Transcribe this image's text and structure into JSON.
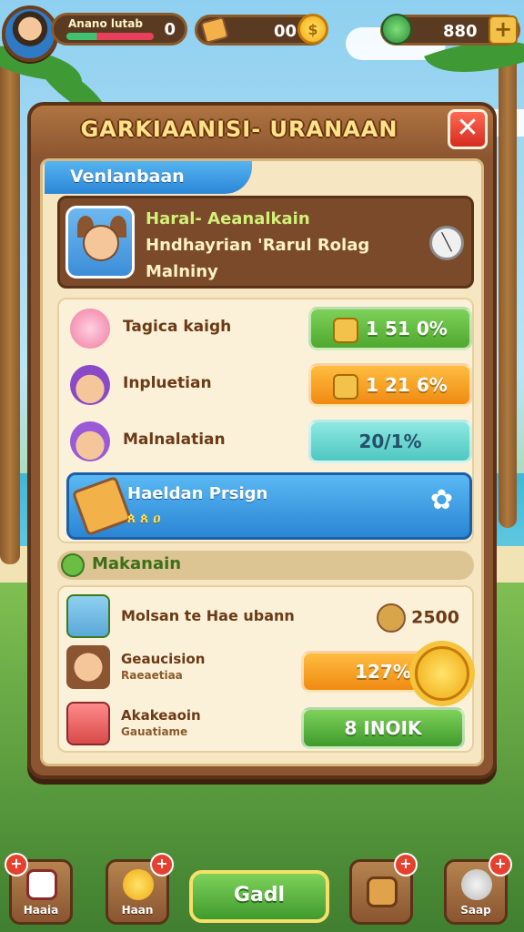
{
  "hud": {
    "player_name": "Anano lutab",
    "player_value": "0",
    "pill_middle_value": "00",
    "pill_right_value": "880",
    "plus_icon": "plus-icon"
  },
  "panel": {
    "title": "GARKIAANISI- URANAAN",
    "close_label": "✕"
  },
  "tab": {
    "label": "Venlanbaan"
  },
  "profile": {
    "line1": "Haral- Aeanalkain",
    "line2": "Hndhayrian 'Rarul Rolag",
    "line3": "Malniny"
  },
  "stats": [
    {
      "label": "Tagica kaigh",
      "value": "1 51 0%",
      "color": "#5cbc3a"
    },
    {
      "label": "Inpluetian",
      "value": "1 21 6%",
      "color": "#f29c1f"
    },
    {
      "label": "Malnalatian",
      "value": "20/1%",
      "color": "#5fd2cc"
    }
  ],
  "highlight": {
    "title": "Haeldan Prsign",
    "subtitle": "ጰ ጰ ዐ"
  },
  "section": {
    "title": "Makanain"
  },
  "tasks": [
    {
      "title": "Molsan te Hae ubann",
      "reward": "2500"
    },
    {
      "title": "Geaucision",
      "sub": "Raeaetiaa",
      "button": "127%",
      "color": "#f29c1f"
    },
    {
      "title": "Akakeaoin",
      "sub": "Gauatiame",
      "button": "8 INOIK",
      "color": "#4fb33a"
    }
  ],
  "nav": {
    "home_label": "Haaia",
    "hero_label": "Haan",
    "main_label": "Gadl",
    "bag_label": "",
    "shop_label": "Saap",
    "badge": "+"
  }
}
